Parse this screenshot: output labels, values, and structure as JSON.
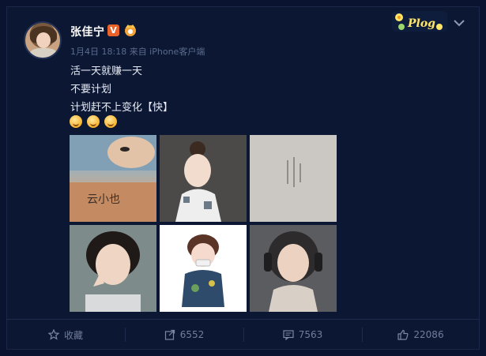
{
  "post": {
    "username": "张佳宁",
    "verified_label": "V",
    "meta": "1月4日 18:18 来自 iPhone客户端",
    "lines": [
      "活一天就赚一天",
      "不要计划",
      "计划赶不上变化【快】"
    ],
    "emoji_icons": [
      "smile-kiss-icon",
      "grin-icon",
      "happy-icon"
    ],
    "badge_text": "Plog"
  },
  "photos": [
    {
      "name": "photo-1",
      "caption": "云小也"
    },
    {
      "name": "photo-2"
    },
    {
      "name": "photo-3"
    },
    {
      "name": "photo-4"
    },
    {
      "name": "photo-5"
    },
    {
      "name": "photo-6"
    }
  ],
  "toolbar": {
    "favorite": "收藏",
    "repost": "6552",
    "comment": "7563",
    "like": "22086"
  },
  "colors": {
    "background": "#0a1430",
    "card": "#0c1734",
    "accent": "#e8622a",
    "muted": "#6f7e9c"
  }
}
